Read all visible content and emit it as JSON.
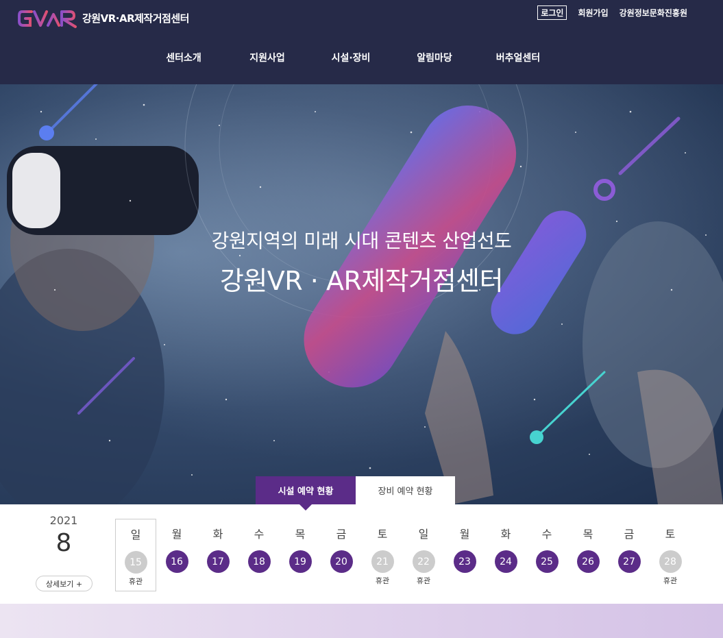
{
  "header": {
    "logo_mark": "GVAR",
    "site_title": "강원VR·AR제작거점센터",
    "util": {
      "login": "로그인",
      "join": "회원가입",
      "org": "강원정보문화진흥원"
    },
    "nav": [
      "센터소개",
      "지원사업",
      "시설·장비",
      "알림마당",
      "버추얼센터"
    ]
  },
  "hero": {
    "subtitle": "강원지역의 미래 시대 콘텐츠 산업선도",
    "title": "강원VR · AR제작거점센터"
  },
  "tabs": {
    "facility": "시설 예약 현황",
    "equipment": "장비 예약 현황",
    "active": "facility"
  },
  "calendar": {
    "year": "2021",
    "month": "8",
    "detail_button": "상세보기 +",
    "days": [
      {
        "dow": "일",
        "date": "15",
        "note": "휴관",
        "closed": true,
        "today": true
      },
      {
        "dow": "월",
        "date": "16",
        "note": "",
        "closed": false
      },
      {
        "dow": "화",
        "date": "17",
        "note": "",
        "closed": false
      },
      {
        "dow": "수",
        "date": "18",
        "note": "",
        "closed": false
      },
      {
        "dow": "목",
        "date": "19",
        "note": "",
        "closed": false
      },
      {
        "dow": "금",
        "date": "20",
        "note": "",
        "closed": false
      },
      {
        "dow": "토",
        "date": "21",
        "note": "휴관",
        "closed": true
      },
      {
        "dow": "일",
        "date": "22",
        "note": "휴관",
        "closed": true
      },
      {
        "dow": "월",
        "date": "23",
        "note": "",
        "closed": false
      },
      {
        "dow": "화",
        "date": "24",
        "note": "",
        "closed": false
      },
      {
        "dow": "수",
        "date": "25",
        "note": "",
        "closed": false
      },
      {
        "dow": "목",
        "date": "26",
        "note": "",
        "closed": false
      },
      {
        "dow": "금",
        "date": "27",
        "note": "",
        "closed": false
      },
      {
        "dow": "토",
        "date": "28",
        "note": "휴관",
        "closed": true
      }
    ]
  },
  "colors": {
    "header_bg": "#262a48",
    "accent_purple": "#5b2c88",
    "closed_gray": "#cccccc"
  }
}
